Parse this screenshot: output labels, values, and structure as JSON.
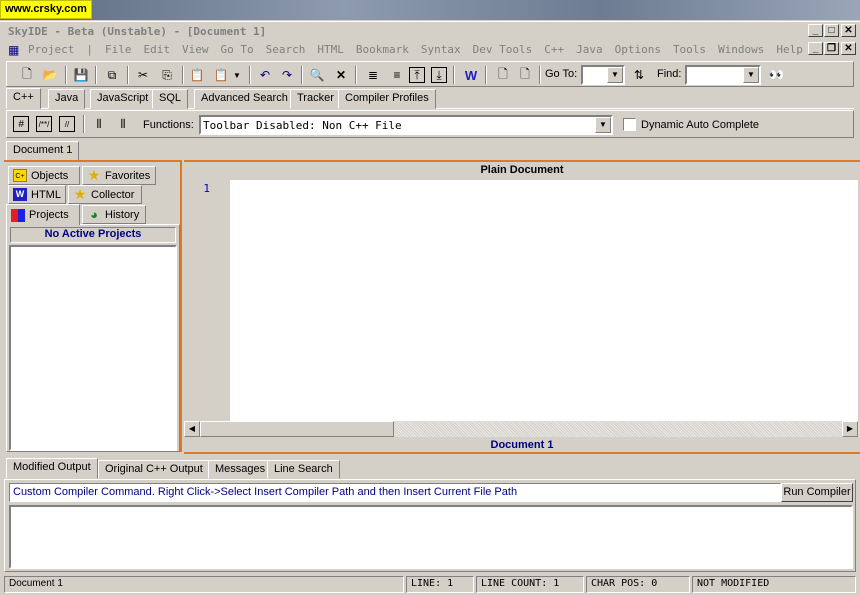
{
  "watermark": "www.crsky.com",
  "window": {
    "title": "SkyIDE - Beta (Unstable) - [Document 1]"
  },
  "menu": [
    "Project",
    "File",
    "Edit",
    "View",
    "Go To",
    "Search",
    "HTML",
    "Bookmark",
    "Syntax",
    "Dev Tools",
    "C++",
    "Java",
    "Options",
    "Tools",
    "Windows",
    "Help"
  ],
  "toolbar": {
    "goto_label": "Go To:",
    "find_label": "Find:",
    "goto_value": "",
    "find_value": ""
  },
  "lang_tabs": [
    "C++",
    "Java",
    "JavaScript",
    "SQL",
    "Advanced Search",
    "Tracker",
    "Compiler Profiles"
  ],
  "functions_toolbar": {
    "label": "Functions:",
    "value": "Toolbar Disabled: Non C++ File",
    "checkbox_label": "Dynamic Auto Complete",
    "checkbox_checked": false
  },
  "doc_tabs": [
    "Document 1"
  ],
  "left_tabs": {
    "objects": "Objects",
    "favorites": "Favorites",
    "html": "HTML",
    "collector": "Collector",
    "projects": "Projects",
    "history": "History"
  },
  "projects_header": "No Active Projects",
  "editor": {
    "header": "Plain Document",
    "footer": "Document 1",
    "line_numbers": [
      "1"
    ]
  },
  "output_tabs": [
    "Modified Output",
    "Original C++ Output",
    "Messages",
    "Line Search"
  ],
  "output": {
    "command_text": "Custom Compiler Command. Right Click->Select Insert Compiler Path and then Insert Current File Path",
    "run_button": "Run Compiler"
  },
  "status": {
    "doc": "Document 1",
    "line": "LINE: 1",
    "line_count": "LINE COUNT: 1",
    "char_pos": "CHAR POS: 0",
    "modified": "NOT MODIFIED"
  },
  "colors": {
    "accent_orange": "#e07828",
    "navy": "#000080",
    "face": "#d4d0c8"
  }
}
